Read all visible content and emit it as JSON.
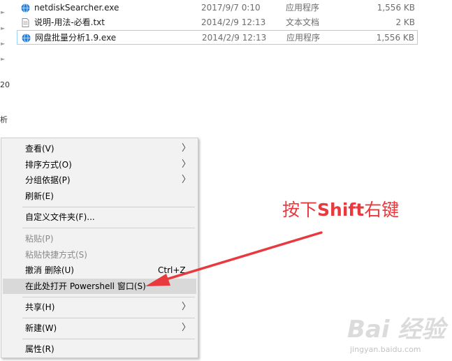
{
  "nav": {
    "fragment_a": "20",
    "fragment_b": "析"
  },
  "files": [
    {
      "name": "netdiskSearcher.exe",
      "date": "2017/9/7 0:10",
      "type": "应用程序",
      "size": "1,556 KB",
      "icon": "exe-globe-icon",
      "selected": false
    },
    {
      "name": "说明-用法-必看.txt",
      "date": "2014/2/9 12:13",
      "type": "文本文档",
      "size": "2 KB",
      "icon": "text-file-icon",
      "selected": false
    },
    {
      "name": "网盘批量分析1.9.exe",
      "date": "2014/2/9 12:13",
      "type": "应用程序",
      "size": "1,556 KB",
      "icon": "exe-globe-icon",
      "selected": true
    }
  ],
  "menu": {
    "view": "查看(V)",
    "sort": "排序方式(O)",
    "group": "分组依据(P)",
    "refresh": "刷新(E)",
    "customize": "自定义文件夹(F)...",
    "paste": "粘贴(P)",
    "paste_shortcut": "粘贴快捷方式(S)",
    "undo": "撤消 删除(U)",
    "undo_shortcut": "Ctrl+Z",
    "powershell": "在此处打开 Powershell 窗口(S)",
    "share": "共享(H)",
    "new": "新建(W)",
    "properties": "属性(R)"
  },
  "annotation": {
    "before": "按下",
    "key": "Shift",
    "after": "右键",
    "color": "#e8393f"
  },
  "watermark": {
    "logo": "Bai 经验",
    "url": "jingyan.baidu.com"
  }
}
